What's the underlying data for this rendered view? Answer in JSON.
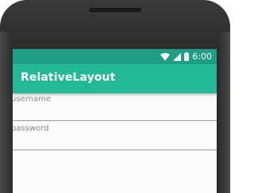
{
  "statusbar": {
    "time": "6:00"
  },
  "appbar": {
    "title": "RelativeLayout"
  },
  "form": {
    "fields": [
      {
        "label": "username",
        "value": "",
        "placeholder": ""
      },
      {
        "label": "password",
        "value": "",
        "placeholder": ""
      }
    ]
  },
  "colors": {
    "statusbar": "#1e9e84",
    "appbar": "#21b996",
    "screen_bg": "#fafafa",
    "device_frame": "#2a2a2a"
  },
  "icons": [
    "wifi-icon",
    "signal-icon",
    "battery-icon"
  ]
}
